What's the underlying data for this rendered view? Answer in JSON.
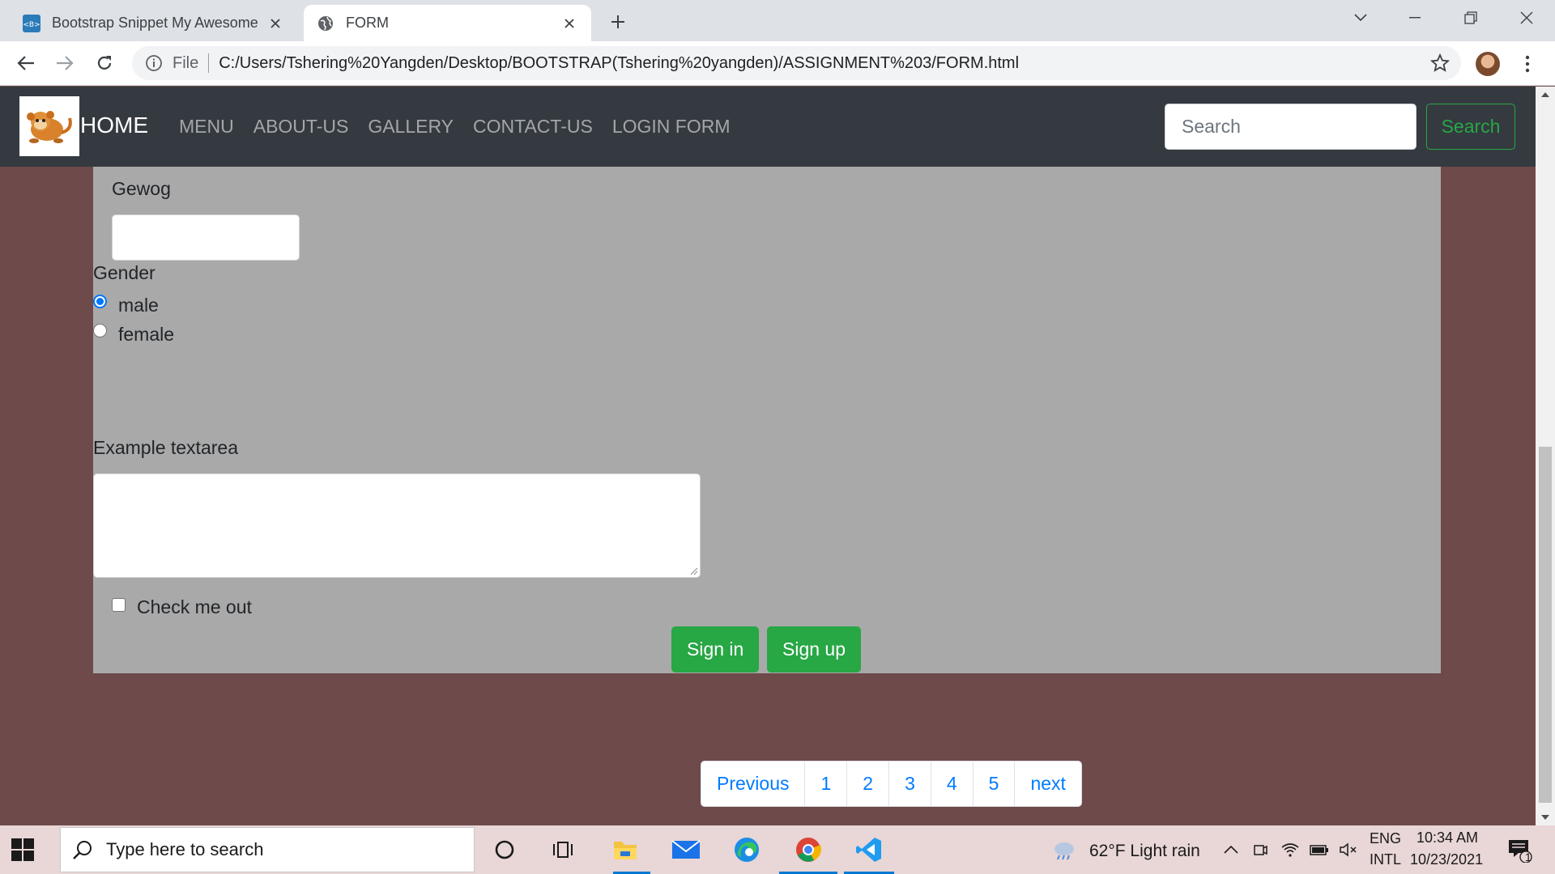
{
  "browser": {
    "tabs": [
      {
        "title": "Bootstrap Snippet My Awesome"
      },
      {
        "title": "FORM"
      }
    ],
    "address": {
      "scheme_label": "File",
      "url": "C:/Users/Tshering%20Yangden/Desktop/BOOTSTRAP(Tshering%20yangden)/ASSIGNMENT%203/FORM.html"
    }
  },
  "navbar": {
    "brand": "HOME",
    "links": [
      "MENU",
      "ABOUT-US",
      "GALLERY",
      "CONTACT-US",
      "LOGIN FORM"
    ],
    "search_placeholder": "Search",
    "search_button": "Search",
    "button_color": "#28a745"
  },
  "form": {
    "gewog_label": "Gewog",
    "gewog_value": "",
    "gender_label": "Gender",
    "gender_options": [
      {
        "label": "male",
        "checked": true
      },
      {
        "label": "female",
        "checked": false
      }
    ],
    "textarea_label": "Example textarea",
    "textarea_value": "",
    "checkbox_label": "Check me out",
    "checkbox_checked": false,
    "sign_in": "Sign in",
    "sign_up": "Sign up"
  },
  "pagination": {
    "previous": "Previous",
    "pages": [
      "1",
      "2",
      "3",
      "4",
      "5"
    ],
    "next": "next"
  },
  "taskbar": {
    "search_placeholder": "Type here to search",
    "weather": "62°F  Light rain",
    "lang_top": "ENG",
    "lang_bottom": "INTL",
    "time": "10:34 AM",
    "date": "10/23/2021",
    "notification_count": "1"
  },
  "colors": {
    "page_background": "#6e4a4a",
    "form_background": "#a9a9a9",
    "navbar": "#343a40",
    "link": "#007bff"
  }
}
